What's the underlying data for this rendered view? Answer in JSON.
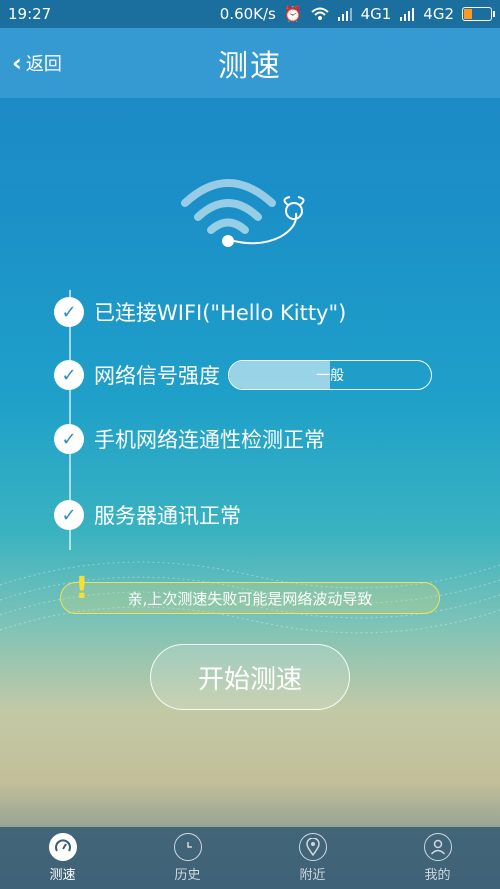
{
  "status_bar": {
    "time": "19:27",
    "speed": "0.60K/s",
    "net1": "4G1",
    "net2": "4G2"
  },
  "header": {
    "back_label": "返回",
    "title": "测速"
  },
  "checks": [
    {
      "text": "已连接WIFI(\"Hello Kitty\")"
    },
    {
      "text": "网络信号强度"
    },
    {
      "text": "手机网络连通性检测正常"
    },
    {
      "text": "服务器通讯正常"
    }
  ],
  "signal": {
    "label": "一般",
    "level_percent": 50
  },
  "notice": {
    "icon": "!",
    "text": "亲,上次测速失败可能是网络波动导致"
  },
  "start_button": {
    "label": "开始测速"
  },
  "tabs": [
    {
      "label": "测速",
      "icon": "speedometer-icon",
      "active": true
    },
    {
      "label": "历史",
      "icon": "clock-icon",
      "active": false
    },
    {
      "label": "附近",
      "icon": "location-pin-icon",
      "active": false
    },
    {
      "label": "我的",
      "icon": "user-icon",
      "active": false
    }
  ],
  "colors": {
    "accent": "#2a8fc4",
    "battery": "#ff9a1f",
    "notice_border": "#f3e05a",
    "notice_icon": "#f7df36"
  }
}
